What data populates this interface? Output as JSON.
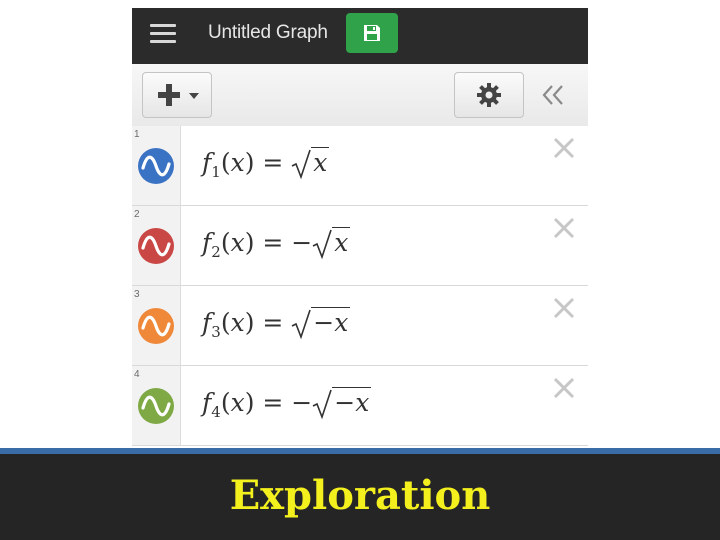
{
  "app": {
    "title": "Untitled Graph",
    "save_color": "#2fa24a"
  },
  "toolbar": {
    "add_icon": "plus-icon",
    "menu_caret_icon": "caret-down-icon",
    "settings_icon": "gear-icon",
    "collapse_icon": "double-chevron-left-icon"
  },
  "expressions": [
    {
      "index": "1",
      "color": "#3b73c4",
      "fname": "f",
      "sub": "1",
      "arg": "x",
      "eq": "=",
      "sign": "",
      "radicand": "x"
    },
    {
      "index": "2",
      "color": "#c94744",
      "fname": "f",
      "sub": "2",
      "arg": "x",
      "eq": "=",
      "sign": "−",
      "radicand": "x"
    },
    {
      "index": "3",
      "color": "#f0883a",
      "fname": "f",
      "sub": "3",
      "arg": "x",
      "eq": "=",
      "sign": "",
      "radicand": "−x"
    },
    {
      "index": "4",
      "color": "#7ea944",
      "fname": "f",
      "sub": "4",
      "arg": "x",
      "eq": "=",
      "sign": "−",
      "radicand": "−x"
    }
  ],
  "caption": {
    "text": "Exploration",
    "color": "#f4f01e"
  }
}
